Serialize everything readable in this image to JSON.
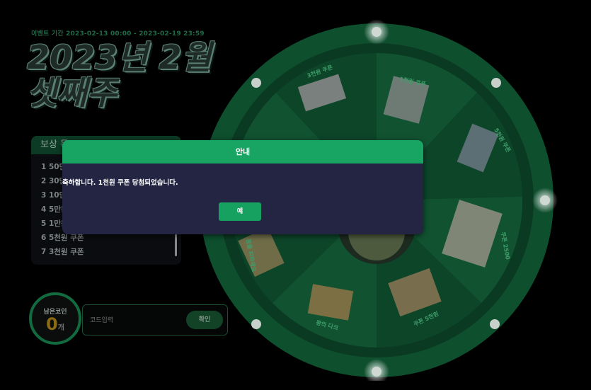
{
  "event": {
    "period": "이벤트 기간 2023-02-13 00:00 - 2023-02-19 23:59",
    "title_line1": "2023년 2월",
    "title_line2": "셋째주"
  },
  "reward": {
    "header": "보상 목",
    "items": [
      "1 50만",
      "2 30만",
      "3 10만",
      "4 5만원",
      "5 1만원",
      "6 5천원 쿠폰",
      "7 3천원 쿠폰"
    ]
  },
  "coin": {
    "label": "남은코인",
    "count": "0",
    "unit": "개"
  },
  "code": {
    "placeholder": "코드입력",
    "confirm_label": "확인"
  },
  "wheel": {
    "segments": [
      {
        "label": "3천원 쿠폰"
      },
      {
        "label": "1천원 쿠폰"
      },
      {
        "label": "5천원 쿠폰"
      },
      {
        "label": "쿠폰 2500"
      },
      {
        "label": "쿠폰 5천원"
      },
      {
        "label": "꽝의 다크"
      },
      {
        "label": "꽝을 피하세요"
      }
    ],
    "colors": {
      "outer": "#0f5a33",
      "ring": "#0b3f24",
      "seg_a": "#0f4d2c",
      "seg_b": "#0c4327",
      "hub": "#2a3a2c",
      "light": "#ffffff"
    }
  },
  "dialog": {
    "title": "안내",
    "message": "축하합니다. 1천원 쿠폰 당첨되었습니다.",
    "ok_label": "예"
  }
}
